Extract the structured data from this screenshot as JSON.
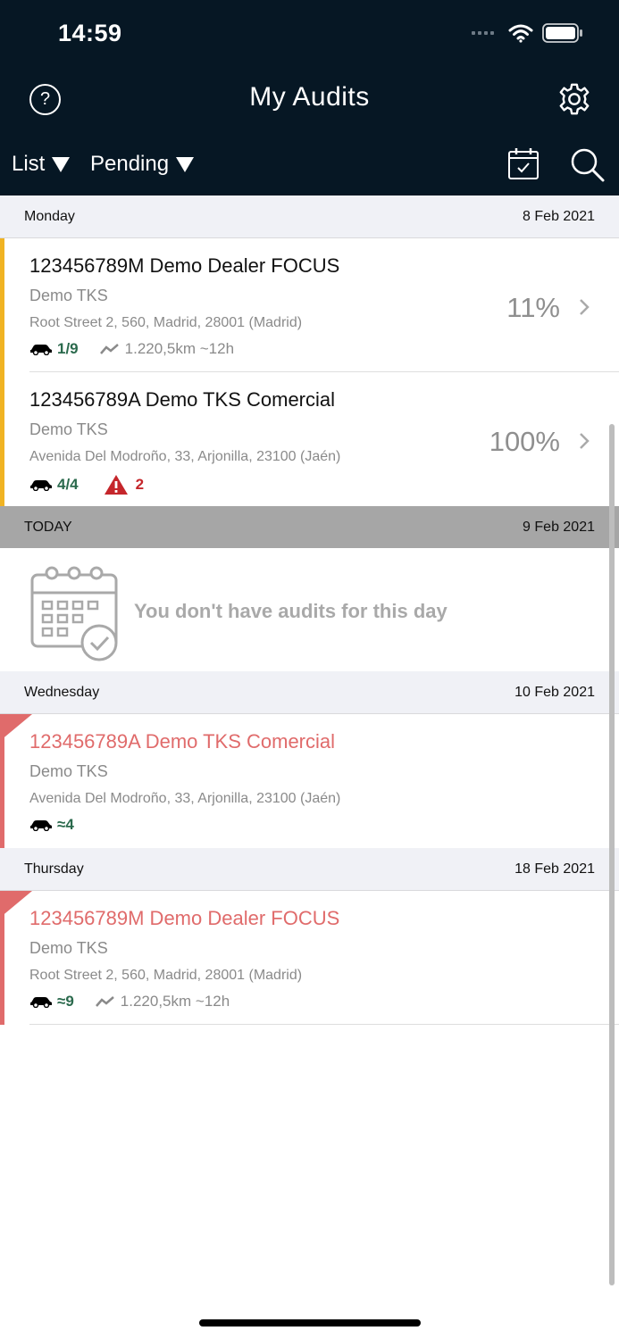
{
  "status_bar": {
    "time": "14:59"
  },
  "header": {
    "title": "My Audits",
    "help_glyph": "?",
    "view_filter": "List",
    "status_filter": "Pending",
    "icons": [
      "help-icon",
      "gear-icon",
      "calendar-check-icon",
      "search-icon"
    ]
  },
  "sections": [
    {
      "day": "Monday",
      "date": "8 Feb 2021",
      "audits": [
        {
          "name": "123456789M Demo Dealer FOCUS",
          "company": "Demo TKS",
          "address": "Root Street 2, 560, Madrid, 28001 (Madrid)",
          "cars": "1/9",
          "route": "1.220,5km ~12h",
          "percent": "11%",
          "accent": "#f0b323"
        },
        {
          "name": "123456789A Demo TKS Comercial",
          "company": "Demo TKS",
          "address": "Avenida Del Modroño, 33, Arjonilla, 23100 (Jaén)",
          "cars": "4/4",
          "warnings": "2",
          "percent": "100%",
          "accent": "#f0b323"
        }
      ]
    },
    {
      "day": "TODAY",
      "date": "9 Feb 2021",
      "empty_message": "You don't have audits for this day"
    },
    {
      "day": "Wednesday",
      "date": "10 Feb 2021",
      "audits": [
        {
          "name": "123456789A Demo TKS Comercial",
          "company": "Demo TKS",
          "address": "Avenida Del Modroño, 33, Arjonilla, 23100 (Jaén)",
          "cars": "≈4",
          "accent": "#e06b6b"
        }
      ]
    },
    {
      "day": "Thursday",
      "date": "18 Feb 2021",
      "audits": [
        {
          "name": "123456789M Demo Dealer FOCUS",
          "company": "Demo TKS",
          "address": "Root Street 2, 560, Madrid, 28001 (Madrid)",
          "cars": "≈9",
          "route": "1.220,5km ~12h",
          "accent": "#e06b6b"
        }
      ]
    }
  ]
}
